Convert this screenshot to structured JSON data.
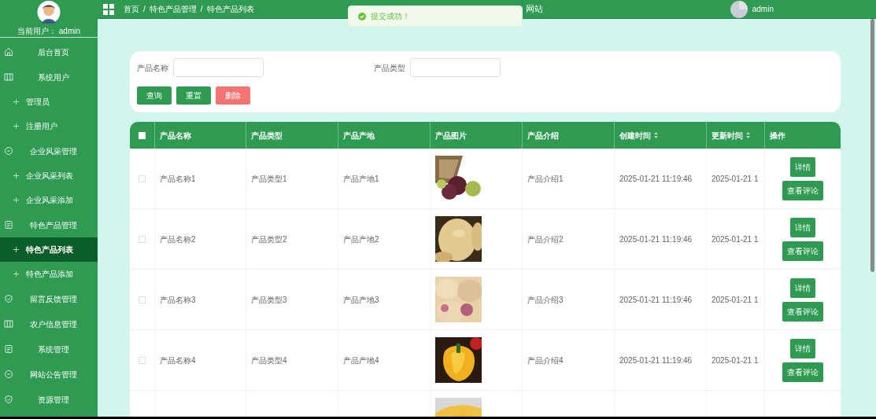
{
  "sidebar": {
    "user_label": "当前用户：",
    "user_name": "admin",
    "menu": [
      {
        "label": "后台首页",
        "kind": "home",
        "selected": false
      },
      {
        "label": "系统用户",
        "kind": "columns",
        "selected": false,
        "children": [
          {
            "label": "管理员",
            "selected": false
          },
          {
            "label": "注册用户",
            "selected": false
          }
        ]
      },
      {
        "label": "企业风采管理",
        "kind": "chat",
        "selected": false,
        "children": [
          {
            "label": "企业风采列表",
            "selected": false
          },
          {
            "label": "企业风采添加",
            "selected": false
          }
        ]
      },
      {
        "label": "特色产品管理",
        "kind": "doc",
        "selected": false,
        "children": [
          {
            "label": "特色产品列表",
            "selected": true
          },
          {
            "label": "特色产品添加",
            "selected": false
          }
        ]
      },
      {
        "label": "留言反馈管理",
        "kind": "shield",
        "selected": false
      },
      {
        "label": "农户信息管理",
        "kind": "columns",
        "selected": false
      },
      {
        "label": "系统管理",
        "kind": "doc",
        "selected": false
      },
      {
        "label": "网站公告管理",
        "kind": "chat",
        "selected": false
      },
      {
        "label": "资源管理",
        "kind": "shield",
        "selected": false
      }
    ]
  },
  "header": {
    "breadcrumb": [
      "首页",
      "特色产品管理",
      "特色产品列表"
    ],
    "separator": "/",
    "title": "网站",
    "user": "admin"
  },
  "toast": {
    "message": "提交成功！",
    "kind": "success"
  },
  "search": {
    "fields": [
      {
        "label": "产品名称"
      },
      {
        "label": "产品类型"
      }
    ],
    "buttons": [
      {
        "label": "查询",
        "kind": "primary"
      },
      {
        "label": "重置",
        "kind": "primary"
      },
      {
        "label": "删除",
        "kind": "danger"
      }
    ]
  },
  "table": {
    "select_all": {
      "checked": false
    },
    "columns": [
      {
        "label": "产品名称",
        "sortable": false
      },
      {
        "label": "产品类型",
        "sortable": false
      },
      {
        "label": "产品产地",
        "sortable": false
      },
      {
        "label": "产品图片",
        "sortable": false
      },
      {
        "label": "产品介绍",
        "sortable": false
      },
      {
        "label": "创建时间",
        "sortable": true
      },
      {
        "label": "更新时间",
        "sortable": true
      },
      {
        "label": "操作",
        "sortable": false
      }
    ],
    "rows": [
      {
        "checked": false,
        "cells": [
          "产品名称1",
          "产品类型1",
          "产品产地1",
          null,
          "产品介绍1",
          "2025-01-21 11:19:46",
          "2025-01-21 1"
        ],
        "actions": [
          "详情",
          "查看评论"
        ]
      },
      {
        "checked": false,
        "cells": [
          "产品名称2",
          "产品类型2",
          "产品产地2",
          null,
          "产品介绍2",
          "2025-01-21 11:19:46",
          "2025-01-21 1"
        ],
        "actions": [
          "详情",
          "查看评论"
        ]
      },
      {
        "checked": false,
        "cells": [
          "产品名称3",
          "产品类型3",
          "产品产地3",
          null,
          "产品介绍3",
          "2025-01-21 11:19:46",
          "2025-01-21 1"
        ],
        "actions": [
          "详情",
          "查看评论"
        ]
      },
      {
        "checked": false,
        "cells": [
          "产品名称4",
          "产品类型4",
          "产品产地4",
          null,
          "产品介绍4",
          "2025-01-21 11:19:46",
          "2025-01-21 1"
        ],
        "actions": [
          "详情",
          "查看评论"
        ]
      },
      {
        "cells": [
          null,
          null,
          null,
          null,
          null,
          null,
          null
        ]
      }
    ]
  }
}
